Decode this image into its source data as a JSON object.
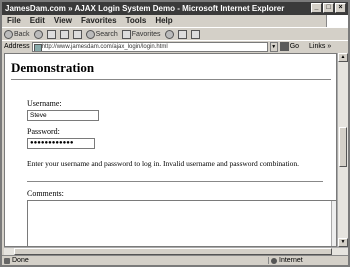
{
  "window": {
    "title": "JamesDam.com » AJAX Login System Demo - Microsoft Internet Explorer",
    "controls": [
      "_",
      "□",
      "×"
    ]
  },
  "menu": [
    "File",
    "Edit",
    "View",
    "Favorites",
    "Tools",
    "Help"
  ],
  "toolbar": {
    "back_label": "Back",
    "search_label": "Search",
    "favorites_label": "Favorites"
  },
  "address": {
    "label": "Address",
    "url": "http://www.jamesdam.com/ajax_login/login.html",
    "go_label": "Go",
    "links_label": "Links »"
  },
  "page": {
    "heading": "Demonstration",
    "username_label": "Username:",
    "username_value": "Steve",
    "password_label": "Password:",
    "password_value": "●●●●●●●●●●●●",
    "message": "Enter your username and password to log in. Invalid username and password combination.",
    "comments_label": "Comments:"
  },
  "status": {
    "left": "Done",
    "zone": "Internet"
  },
  "icons": [
    "back-icon",
    "forward-icon",
    "stop-icon",
    "refresh-icon",
    "home-icon",
    "search-icon",
    "favorites-icon",
    "media-icon",
    "mail-icon",
    "print-icon",
    "go-icon",
    "page-icon",
    "globe-icon"
  ]
}
